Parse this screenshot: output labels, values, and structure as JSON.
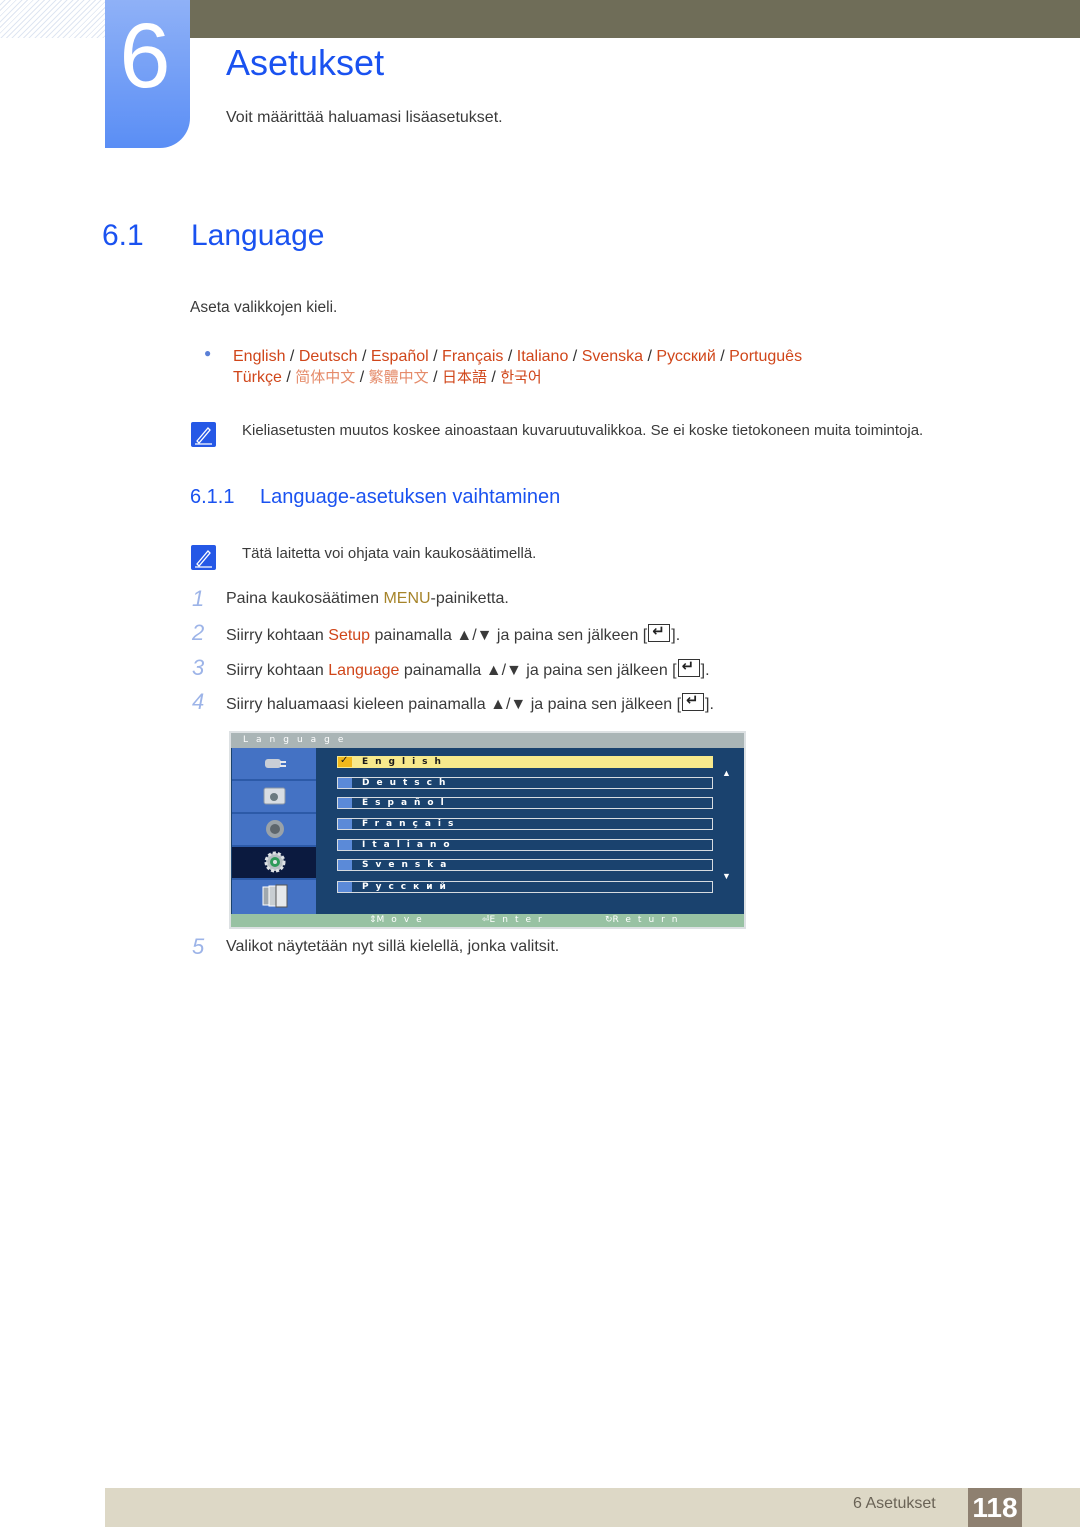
{
  "chapter": {
    "number": "6",
    "title": "Asetukset",
    "subtitle": "Voit määrittää haluamasi lisäasetukset."
  },
  "section": {
    "number": "6.1",
    "title": "Language",
    "intro": "Aseta valikkojen kieli.",
    "languages": [
      "English",
      "Deutsch",
      "Español",
      "Français",
      "Italiano",
      "Svenska",
      "Русский",
      "Português",
      "Türkçe",
      "简体中文",
      "繁體中文",
      "日本語",
      "한국어"
    ],
    "note": "Kieliasetusten muutos koskee ainoastaan kuvaruutuvalikkoa. Se ei koske tietokoneen muita toimintoja."
  },
  "subsection": {
    "number": "6.1.1",
    "title": "Language-asetuksen vaihtaminen",
    "note": "Tätä laitetta voi ohjata vain kaukosäätimellä.",
    "steps": [
      {
        "num": "1",
        "pre": "Paina kaukosäätimen ",
        "hl": "MENU",
        "post": "-painiketta."
      },
      {
        "num": "2",
        "pre": "Siirry kohtaan ",
        "hl": "Setup",
        "post": " painamalla ▲/▼ ja paina sen jälkeen [",
        "end": "]."
      },
      {
        "num": "3",
        "pre": "Siirry kohtaan ",
        "hl": "Language",
        "post": " painamalla ▲/▼ ja paina sen jälkeen [",
        "end": "]."
      },
      {
        "num": "4",
        "pre": "Siirry haluamaasi kieleen painamalla ▲/▼ ja paina sen jälkeen [",
        "end": "]."
      },
      {
        "num": "5",
        "pre": "Valikot näytetään nyt sillä kielellä, jonka valitsit."
      }
    ]
  },
  "osd": {
    "title": "Language",
    "side_icons": [
      "input-icon",
      "picture-icon",
      "sound-icon",
      "setup-icon",
      "multi-window-icon"
    ],
    "active_side": 3,
    "options": [
      "English",
      "Deutsch",
      "Español",
      "Français",
      "Italiano",
      "Svenska",
      "Русский"
    ],
    "selected": "English",
    "footer": {
      "move": "Move",
      "enter": "Enter",
      "return": "Return"
    }
  },
  "footer": {
    "chapter_label": "6 Asetukset",
    "page": "118"
  }
}
